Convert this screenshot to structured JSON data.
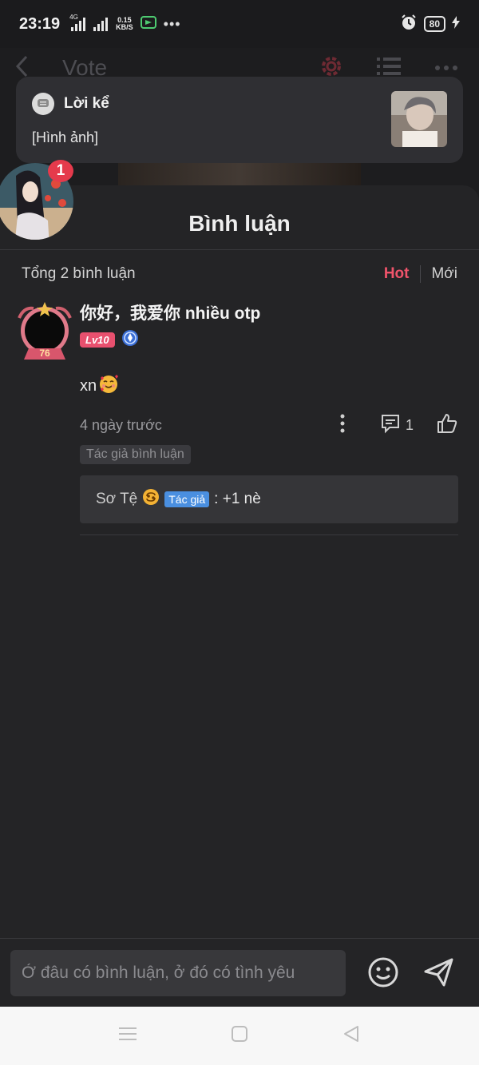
{
  "status_bar": {
    "time": "23:19",
    "network_type": "4G",
    "net_speed_value": "0.15",
    "net_speed_unit": "KB/S",
    "battery": "80",
    "icons": [
      "signal-icon",
      "signal-icon",
      "app-notification-icon",
      "more-dots-icon",
      "alarm-icon",
      "battery-icon",
      "charging-icon"
    ]
  },
  "header": {
    "title": "Vote"
  },
  "notification": {
    "app_name": "Lời kể",
    "message": "[Hình ảnh]"
  },
  "floating_avatar": {
    "badge_count": "1"
  },
  "comments_sheet": {
    "title": "Bình luận",
    "total": "Tổng 2 bình luận",
    "sort_hot": "Hot",
    "sort_new": "Mới"
  },
  "comment": {
    "author": "你好，我爱你 nhiều otp",
    "level": "Lv10",
    "avatar_frame_number": "76",
    "text": "xn",
    "time": "4 ngày trước",
    "reply_count": "1",
    "author_tag": "Tác giả bình luận",
    "reply": {
      "name": "Sơ Tệ",
      "tag": "Tác giả",
      "text": ": +1 nè"
    }
  },
  "input": {
    "placeholder": "Ở đâu có bình luận, ở đó có tình yêu"
  },
  "colors": {
    "accent_hot": "#f0546b",
    "level_badge": "#e8506e",
    "author_tag_blue": "#4a8fe0",
    "notification_badge": "#e53a4c"
  }
}
